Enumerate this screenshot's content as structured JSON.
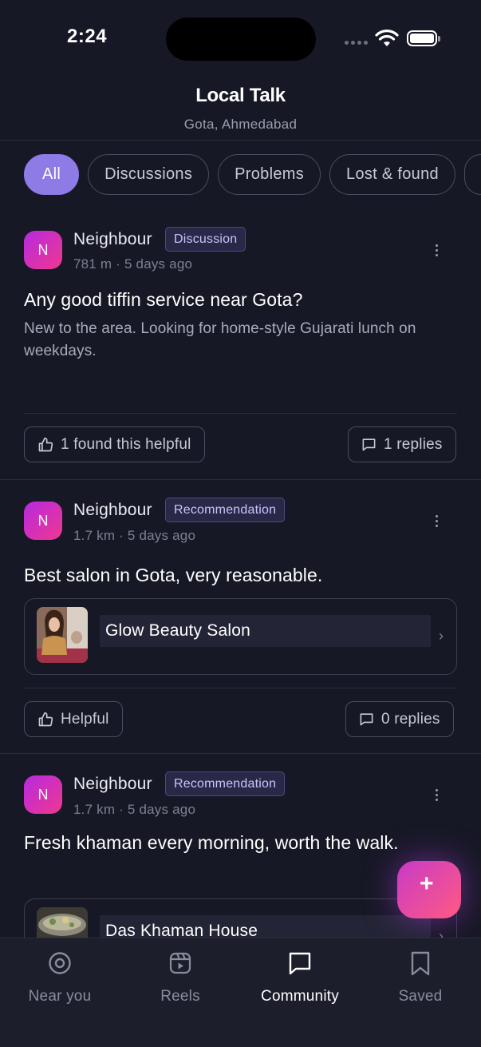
{
  "status_bar": {
    "time": "2:24"
  },
  "header": {
    "title": "Local Talk",
    "subtitle": "Gota, Ahmedabad"
  },
  "filters": [
    {
      "label": "All",
      "active": true
    },
    {
      "label": "Discussions",
      "active": false
    },
    {
      "label": "Problems",
      "active": false
    },
    {
      "label": "Lost & found",
      "active": false
    },
    {
      "label": "",
      "active": false
    }
  ],
  "posts": [
    {
      "avatar_initial": "N",
      "author": "Neighbour",
      "tag": "Discussion",
      "meta": "781 m · 5 days ago",
      "title": "Any good tiffin service near Gota?",
      "body": "New to the area. Looking for home-style Gujarati lunch on weekdays.",
      "helpful_label": "1 found this helpful",
      "replies_label": "1 replies"
    },
    {
      "avatar_initial": "N",
      "author": "Neighbour",
      "tag": "Recommendation",
      "meta": "1.7 km · 5 days ago",
      "title": "Best salon in Gota, very reasonable.",
      "business": {
        "name": "Glow Beauty Salon"
      },
      "helpful_label": "Helpful",
      "replies_label": "0 replies"
    },
    {
      "avatar_initial": "N",
      "author": "Neighbour",
      "tag": "Recommendation",
      "meta": "1.7 km · 5 days ago",
      "title": "Fresh khaman every morning, worth the walk.",
      "business": {
        "name": "Das Khaman House"
      }
    }
  ],
  "fab": {
    "icon": "plus-icon",
    "label": "+"
  },
  "tabs": [
    {
      "label": "Near you",
      "icon": "target-icon",
      "active": false
    },
    {
      "label": "Reels",
      "icon": "reels-icon",
      "active": false
    },
    {
      "label": "Community",
      "icon": "chat-bubble-icon",
      "active": true
    },
    {
      "label": "Saved",
      "icon": "bookmark-icon",
      "active": false
    }
  ],
  "colors": {
    "background": "#171826",
    "accent": "#8E7BE6",
    "avatar_gradient_start": "#B62AE0",
    "avatar_gradient_end": "#F0378F",
    "badge_bg": "#2A2847",
    "tabbar_bg": "#1D1E2C"
  }
}
